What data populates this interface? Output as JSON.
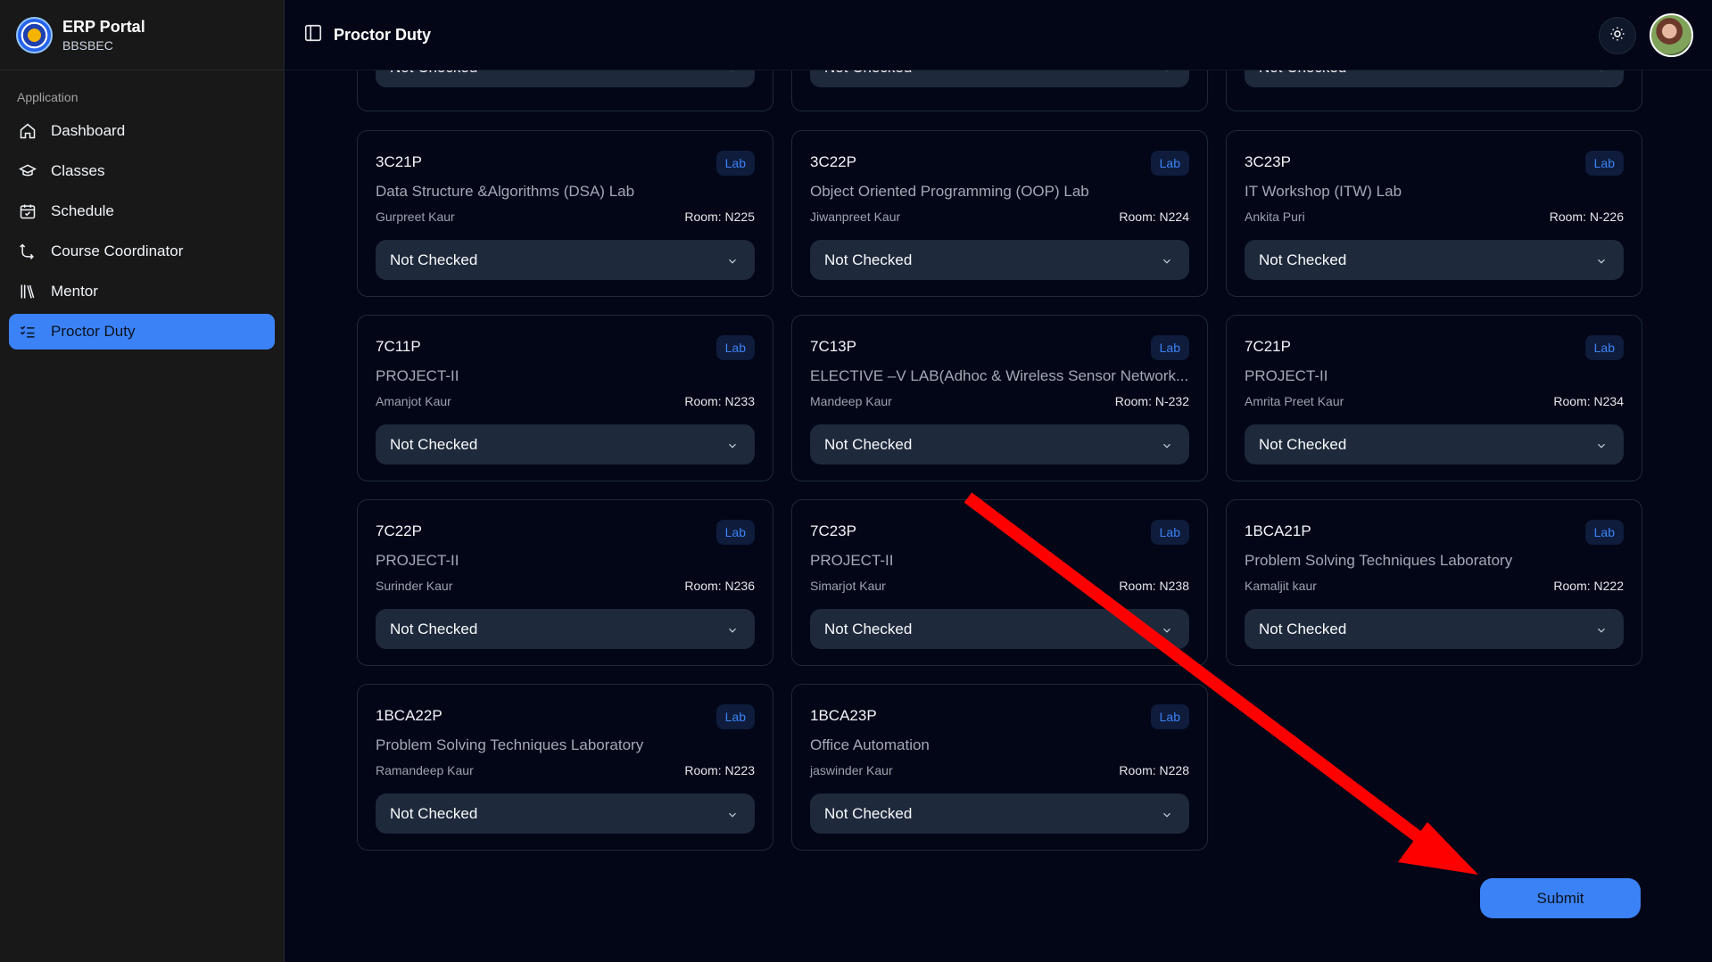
{
  "brand": {
    "title": "ERP Portal",
    "subtitle": "BBSBEC"
  },
  "sidebar": {
    "group_label": "Application",
    "items": [
      {
        "label": "Dashboard",
        "icon": "home-icon"
      },
      {
        "label": "Classes",
        "icon": "graduation-cap-icon"
      },
      {
        "label": "Schedule",
        "icon": "calendar-check-icon"
      },
      {
        "label": "Course Coordinator",
        "icon": "route-icon"
      },
      {
        "label": "Mentor",
        "icon": "library-icon"
      },
      {
        "label": "Proctor Duty",
        "icon": "list-checks-icon",
        "active": true
      }
    ]
  },
  "header": {
    "title": "Proctor Duty"
  },
  "cards_partial": [
    {
      "status": "Not Checked"
    },
    {
      "status": "Not Checked"
    },
    {
      "status": "Not Checked"
    }
  ],
  "cards": [
    {
      "code": "3C21P",
      "type": "Lab",
      "subject": "Data Structure &Algorithms (DSA) Lab",
      "faculty": "Gurpreet Kaur",
      "room": "Room: N225",
      "status": "Not Checked"
    },
    {
      "code": "3C22P",
      "type": "Lab",
      "subject": "Object Oriented Programming (OOP) Lab",
      "faculty": "Jiwanpreet Kaur",
      "room": "Room: N224",
      "status": "Not Checked"
    },
    {
      "code": "3C23P",
      "type": "Lab",
      "subject": "IT Workshop (ITW) Lab",
      "faculty": "Ankita Puri",
      "room": "Room: N-226",
      "status": "Not Checked"
    },
    {
      "code": "7C11P",
      "type": "Lab",
      "subject": "PROJECT-II",
      "faculty": "Amanjot Kaur",
      "room": "Room: N233",
      "status": "Not Checked"
    },
    {
      "code": "7C13P",
      "type": "Lab",
      "subject": "ELECTIVE –V LAB(Adhoc & Wireless Sensor Network...",
      "faculty": "Mandeep Kaur",
      "room": "Room: N-232",
      "status": "Not Checked"
    },
    {
      "code": "7C21P",
      "type": "Lab",
      "subject": "PROJECT-II",
      "faculty": "Amrita Preet Kaur",
      "room": "Room: N234",
      "status": "Not Checked"
    },
    {
      "code": "7C22P",
      "type": "Lab",
      "subject": "PROJECT-II",
      "faculty": "Surinder Kaur",
      "room": "Room: N236",
      "status": "Not Checked"
    },
    {
      "code": "7C23P",
      "type": "Lab",
      "subject": "PROJECT-II",
      "faculty": "Simarjot Kaur",
      "room": "Room: N238",
      "status": "Not Checked"
    },
    {
      "code": "1BCA21P",
      "type": "Lab",
      "subject": "Problem Solving Techniques Laboratory",
      "faculty": "Kamaljit kaur",
      "room": "Room: N222",
      "status": "Not Checked"
    },
    {
      "code": "1BCA22P",
      "type": "Lab",
      "subject": "Problem Solving Techniques Laboratory",
      "faculty": "Ramandeep Kaur",
      "room": "Room: N223",
      "status": "Not Checked"
    },
    {
      "code": "1BCA23P",
      "type": "Lab",
      "subject": "Office Automation",
      "faculty": "jaswinder Kaur",
      "room": "Room: N228",
      "status": "Not Checked"
    }
  ],
  "submit_label": "Submit",
  "colors": {
    "accent": "#3b82f6",
    "annotation_arrow": "#ff0000"
  }
}
